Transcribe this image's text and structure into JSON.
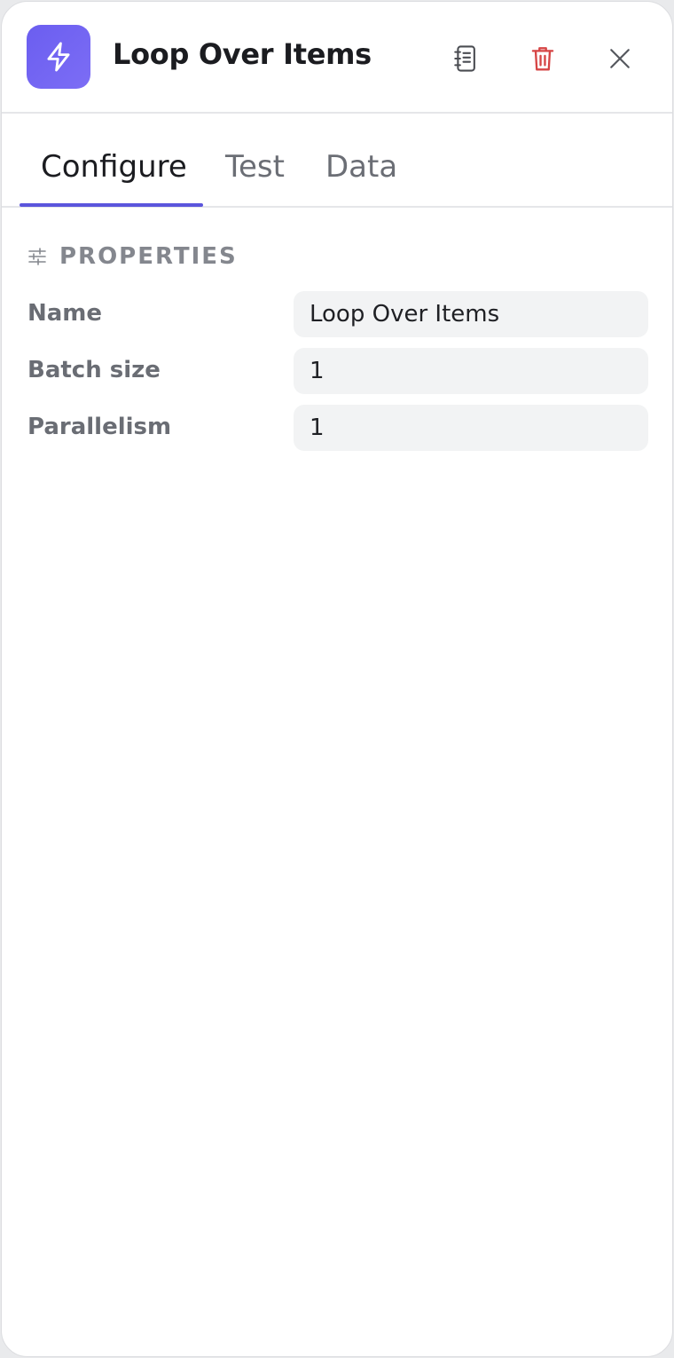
{
  "header": {
    "title": "Loop Over Items",
    "node_icon": "lightning-bolt-icon",
    "actions": {
      "notes_icon": "notebook-icon",
      "delete_icon": "trash-icon",
      "close_icon": "close-icon"
    }
  },
  "tabs": [
    {
      "label": "Configure",
      "active": true
    },
    {
      "label": "Test",
      "active": false
    },
    {
      "label": "Data",
      "active": false
    }
  ],
  "properties": {
    "section_title": "PROPERTIES",
    "section_icon": "sliders-icon",
    "fields": [
      {
        "label": "Name",
        "value": "Loop Over Items"
      },
      {
        "label": "Batch size",
        "value": "1"
      },
      {
        "label": "Parallelism",
        "value": "1"
      }
    ]
  },
  "colors": {
    "accent": "#5b55dc",
    "node_icon_bg": "#6b5ef0",
    "delete": "#d64545",
    "field_bg": "#f2f3f4"
  }
}
